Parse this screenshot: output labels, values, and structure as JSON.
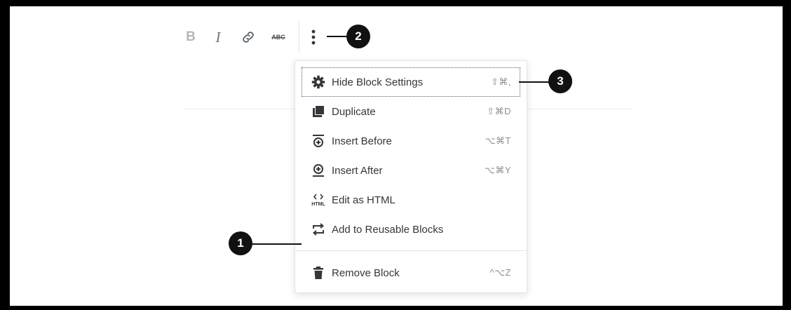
{
  "toolbar": {
    "bold_label": "B",
    "italic_label": "I",
    "link_icon": "link-icon",
    "strikethrough_label": "ABC",
    "more_icon": "vertical-ellipsis-icon"
  },
  "menu": {
    "items": [
      {
        "label": "Hide Block Settings",
        "shortcut": "⇧⌘,",
        "icon": "gear-icon"
      },
      {
        "label": "Duplicate",
        "shortcut": "⇧⌘D",
        "icon": "duplicate-icon"
      },
      {
        "label": "Insert Before",
        "shortcut": "⌥⌘T",
        "icon": "insert-before-icon"
      },
      {
        "label": "Insert After",
        "shortcut": "⌥⌘Y",
        "icon": "insert-after-icon"
      },
      {
        "label": "Edit as HTML",
        "shortcut": "",
        "icon": "html-icon"
      },
      {
        "label": "Add to Reusable Blocks",
        "shortcut": "",
        "icon": "reusable-block-icon"
      }
    ],
    "remove": {
      "label": "Remove Block",
      "shortcut": "^⌥Z",
      "icon": "trash-icon"
    }
  },
  "callouts": {
    "one": "1",
    "two": "2",
    "three": "3"
  }
}
